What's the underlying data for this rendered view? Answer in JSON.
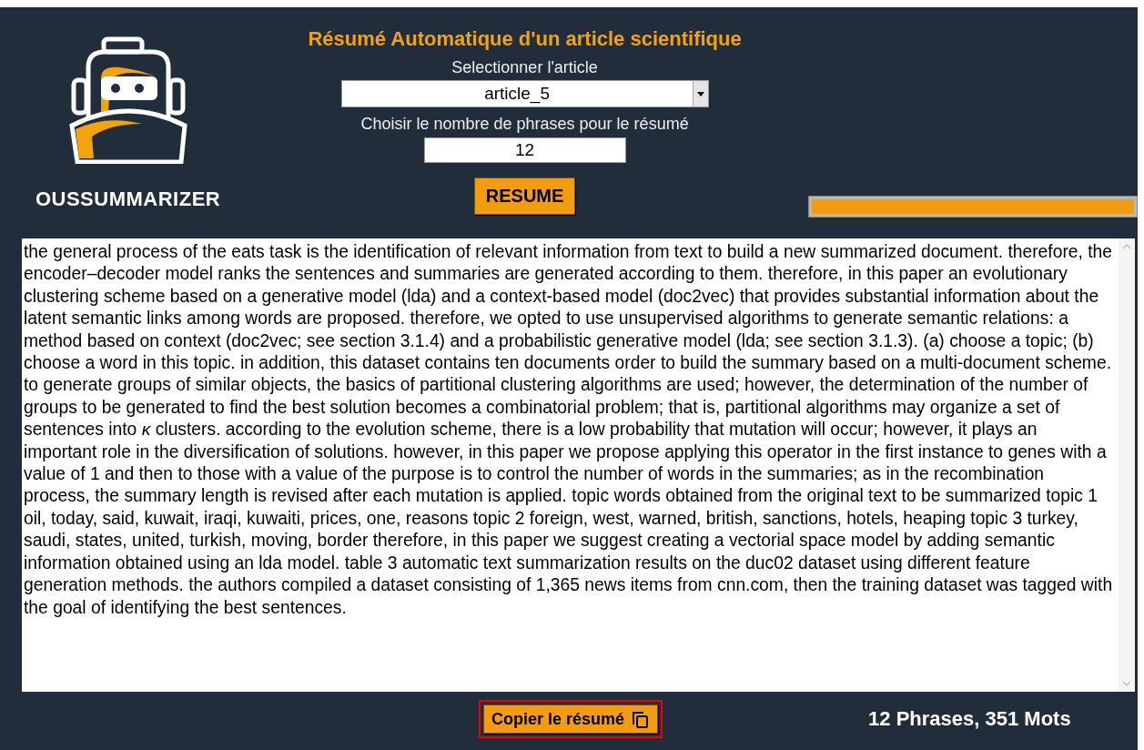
{
  "logo": {
    "name": "OUSSUMMARIZER"
  },
  "title": "Résumé Automatique d'un article scientifique",
  "article_select": {
    "label": "Selectionner l'article",
    "value": "article_5"
  },
  "sentence_count": {
    "label": "Choisir le nombre de phrases pour le résumé",
    "value": "12"
  },
  "resume_button": "RESUME",
  "progress": {
    "level": 1
  },
  "summary_text": " the general process of the eats task is the identification of relevant information from text to build a new summarized document. therefore, the encoder–decoder model ranks the sentences and summaries are generated according to them. therefore, in this paper an evolutionary clustering scheme based on a generative model (lda) and a context-based model (doc2vec) that provides substantial information about the latent semantic links among words are proposed. therefore, we opted to use unsupervised algorithms to generate semantic relations: a method based on context (doc2vec; see section 3.1.4) and a probabilistic generative model (lda; see section 3.1.3). (a) choose a topic; (b) choose a word in this topic. in addition, this dataset contains ten documents order to build the summary based on a multi-document scheme. to generate groups of similar objects, the basics of partitional clustering algorithms are used; however, the determination of the number of groups to be generated to find the best solution becomes a combinatorial problem; that is, partitional algorithms may organize a set of sentences into *κ* clusters. according to the evolution scheme, there is a low probability that mutation will occur; however, it plays an important role in the diversification of solutions. however, in this paper we propose applying this operator in the first instance to genes with a value of 1 and then to those with a value of the purpose is to control the number of words in the summaries; as in the recombination process, the summary length is revised after each mutation is applied. topic words obtained from the original text to be summarized topic 1 oil, today, said, kuwait, iraqi, kuwaiti, prices, one, reasons topic 2 foreign, west, warned, british, sanctions, hotels, heaping topic 3 turkey, saudi, states, united, turkish, moving, border therefore, in this paper we suggest creating a vectorial space model by adding semantic information obtained using an lda model. table 3 automatic text summarization results on the duc02 dataset using different feature generation methods. the authors compiled a dataset consisting of 1,365 news items from cnn.com, then the training dataset was tagged with the goal of identifying the best sentences.",
  "copy_button": {
    "label": "Copier le résumé",
    "highlighted": true
  },
  "stats": "12 Phrases, 351 Mots"
}
